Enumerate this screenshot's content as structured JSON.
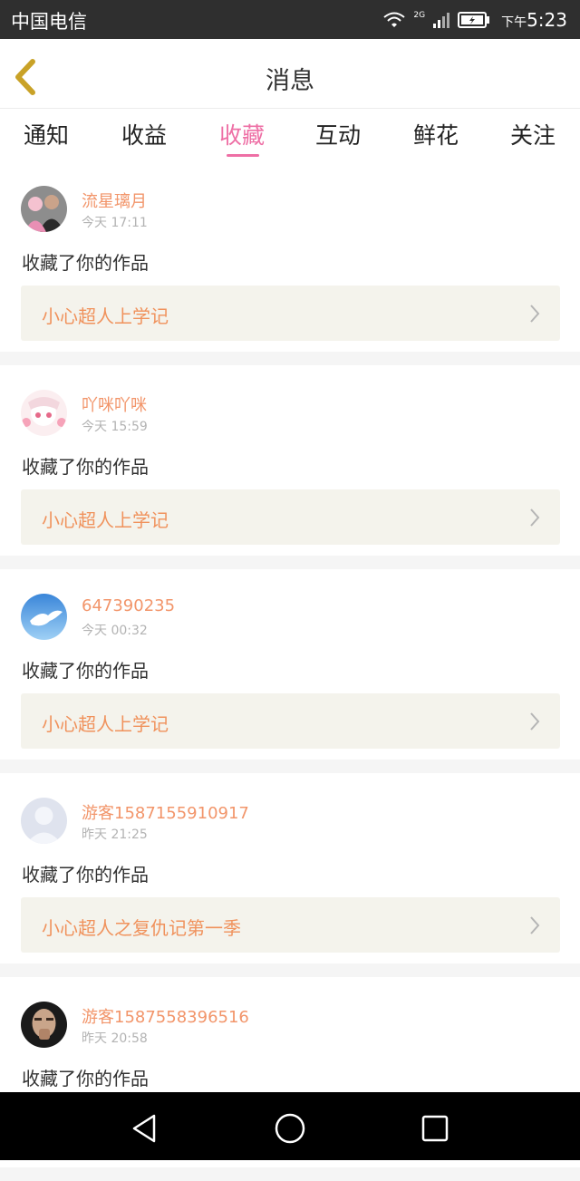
{
  "status_bar": {
    "carrier": "中国电信",
    "network": "2G",
    "time_prefix": "下午",
    "time": "5:23"
  },
  "header": {
    "title": "消息",
    "back_icon": "chevron-left-icon"
  },
  "tabs": [
    {
      "label": "通知",
      "active": false
    },
    {
      "label": "收益",
      "active": false
    },
    {
      "label": "收藏",
      "active": true
    },
    {
      "label": "互动",
      "active": false
    },
    {
      "label": "鲜花",
      "active": false
    },
    {
      "label": "关注",
      "active": false
    }
  ],
  "colors": {
    "accent": "#ee6fa5",
    "username": "#f2956a",
    "work_title": "#f0925c",
    "work_bg": "#f4f3ec"
  },
  "items": [
    {
      "username": "流星璃月",
      "time": "今天 17:11",
      "action": "收藏了你的作品",
      "work_title": "小心超人上学记"
    },
    {
      "username": "吖咪吖咪",
      "time": "今天 15:59",
      "action": "收藏了你的作品",
      "work_title": "小心超人上学记"
    },
    {
      "username": "647390235",
      "time": "今天 00:32",
      "action": "收藏了你的作品",
      "work_title": "小心超人上学记"
    },
    {
      "username": "游客1587155910917",
      "time": "昨天 21:25",
      "action": "收藏了你的作品",
      "work_title": "小心超人之复仇记第一季"
    },
    {
      "username": "游客1587558396516",
      "time": "昨天 20:58",
      "action": "收藏了你的作品",
      "work_title": ""
    }
  ],
  "nav_bar": {
    "back_icon": "triangle-back-icon",
    "home_icon": "circle-home-icon",
    "recents_icon": "square-recents-icon"
  }
}
